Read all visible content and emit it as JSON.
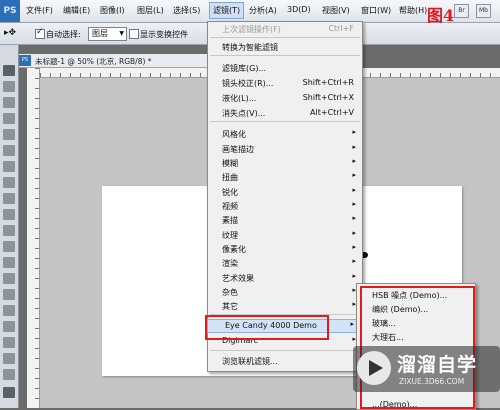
{
  "menubar": {
    "logo": "PS",
    "items": [
      "文件(F)",
      "编辑(E)",
      "图像(I)",
      "图层(L)",
      "选择(S)",
      "滤镜(T)",
      "分析(A)",
      "3D(D)",
      "视图(V)",
      "窗口(W)",
      "帮助(H)"
    ],
    "active_index": 5,
    "chips": [
      "Br",
      "Mb"
    ],
    "annotation": "图4"
  },
  "options": {
    "auto_select_label": "自动选择:",
    "auto_select_checked": true,
    "layer_select_value": "图层",
    "show_transform_label": "显示变换控件",
    "show_transform_checked": false
  },
  "document": {
    "tab_title": "未标题-1 @ 50% (北京, RGB/8) *",
    "ps_badge": "PS"
  },
  "filter_menu": {
    "last_filter": {
      "label": "上次滤镜操作(F)",
      "shortcut": "Ctrl+F"
    },
    "convert_smart": "转换为智能滤镜",
    "group1": [
      {
        "label": "滤镜库(G)...",
        "shortcut": ""
      },
      {
        "label": "镜头校正(R)...",
        "shortcut": "Shift+Ctrl+R"
      },
      {
        "label": "液化(L)...",
        "shortcut": "Shift+Ctrl+X"
      },
      {
        "label": "消失点(V)...",
        "shortcut": "Alt+Ctrl+V"
      }
    ],
    "categories": [
      "风格化",
      "画笔描边",
      "模糊",
      "扭曲",
      "锐化",
      "视频",
      "素描",
      "纹理",
      "像素化",
      "渲染",
      "艺术效果",
      "杂色",
      "其它"
    ],
    "plugins": [
      "Eye Candy 4000 Demo",
      "Digimarc"
    ],
    "browse": "浏览联机滤镜...",
    "submenu_arrow": "▸"
  },
  "submenu": {
    "items": [
      "HSB 噪点 (Demo)...",
      "编织 (Demo)...",
      "玻璃...",
      "大理石...",
      "",
      "",
      "",
      "",
      "...(Demo)..."
    ]
  },
  "watermark": {
    "title": "溜溜自学",
    "url": "ZIXUE.3D66.COM"
  }
}
